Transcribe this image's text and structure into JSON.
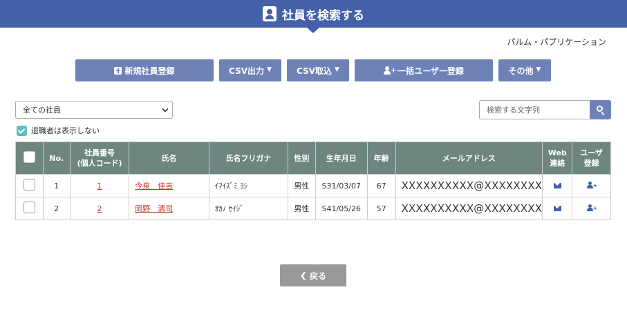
{
  "header": {
    "title": "社員を検索する",
    "icon": "user-card-icon"
  },
  "app_name": "パルム・パプリケーション",
  "toolbar": {
    "new_employee": "新規社員登録",
    "csv_export": "CSV出力",
    "csv_import": "CSV取込",
    "bulk_user_register": "一括ユーザー登録",
    "others": "その他"
  },
  "filter": {
    "selected": "全ての社員"
  },
  "search": {
    "placeholder": "検索する文字列"
  },
  "retired": {
    "label": "退職者は表示しない",
    "checked": true
  },
  "table": {
    "headers": {
      "no": "No.",
      "emp_no_line1": "社員番号",
      "emp_no_line2": "(個人コード)",
      "name": "氏名",
      "kana": "氏名フリガナ",
      "gender": "性別",
      "birth": "生年月日",
      "age": "年齢",
      "email": "メールアドレス",
      "web_line1": "Web",
      "web_line2": "連絡",
      "user_line1": "ユーザ",
      "user_line2": "登録"
    },
    "rows": [
      {
        "no": "1",
        "emp_no": "1",
        "name": "今泉　佳吉",
        "kana": "ｲﾏｲｽﾞﾐ ﾖｼ",
        "gender": "男性",
        "birth": "S31/03/07",
        "age": "67",
        "email": "XXXXXXXXXX@XXXXXXXX"
      },
      {
        "no": "2",
        "emp_no": "2",
        "name": "岡野　清司",
        "kana": "ｵｶﾉ ｾｲｼﾞ",
        "gender": "男性",
        "birth": "S41/05/26",
        "age": "57",
        "email": "XXXXXXXXXX@XXXXXXXX"
      }
    ]
  },
  "back_button": "戻る",
  "colors": {
    "header": "#4360a8",
    "button": "#6e82b8",
    "table_head": "#6e8580",
    "link": "#c0392b",
    "check": "#5bbfbf"
  }
}
